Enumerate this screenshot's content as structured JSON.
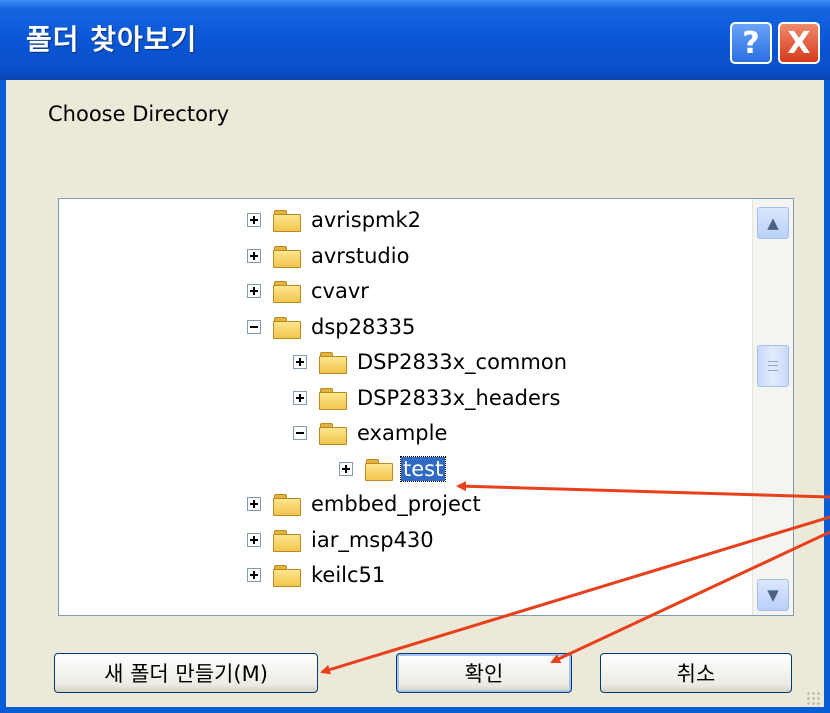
{
  "window": {
    "title": "폴더 찾아보기",
    "help_label": "?",
    "close_label": "X"
  },
  "prompt": "Choose Directory",
  "tree": {
    "items": [
      {
        "label": "avrispmk2",
        "expander": "plus",
        "selected": false
      },
      {
        "label": "avrstudio",
        "expander": "plus",
        "selected": false
      },
      {
        "label": "cvavr",
        "expander": "plus",
        "selected": false
      },
      {
        "label": "dsp28335",
        "expander": "minus",
        "selected": false
      },
      {
        "label": "DSP2833x_common",
        "expander": "plus",
        "selected": false
      },
      {
        "label": "DSP2833x_headers",
        "expander": "plus",
        "selected": false
      },
      {
        "label": "example",
        "expander": "minus",
        "selected": false
      },
      {
        "label": "test",
        "expander": "plus",
        "selected": true
      },
      {
        "label": "embbed_project",
        "expander": "plus",
        "selected": false
      },
      {
        "label": "iar_msp430",
        "expander": "plus",
        "selected": false
      },
      {
        "label": "keilc51",
        "expander": "plus",
        "selected": false
      }
    ]
  },
  "buttons": {
    "new_folder": "새 폴더 만들기(M)",
    "ok": "확인",
    "cancel": "취소"
  },
  "colors": {
    "titlebar": "#0a57d6",
    "selection": "#316ac5",
    "annotation_arrow": "#e8401c",
    "dialog_face": "#ece9d8"
  },
  "icons": {
    "help": "help-icon",
    "close": "close-icon",
    "folder": "folder-icon",
    "scroll_up": "scroll-up-icon",
    "scroll_down": "scroll-down-icon"
  }
}
